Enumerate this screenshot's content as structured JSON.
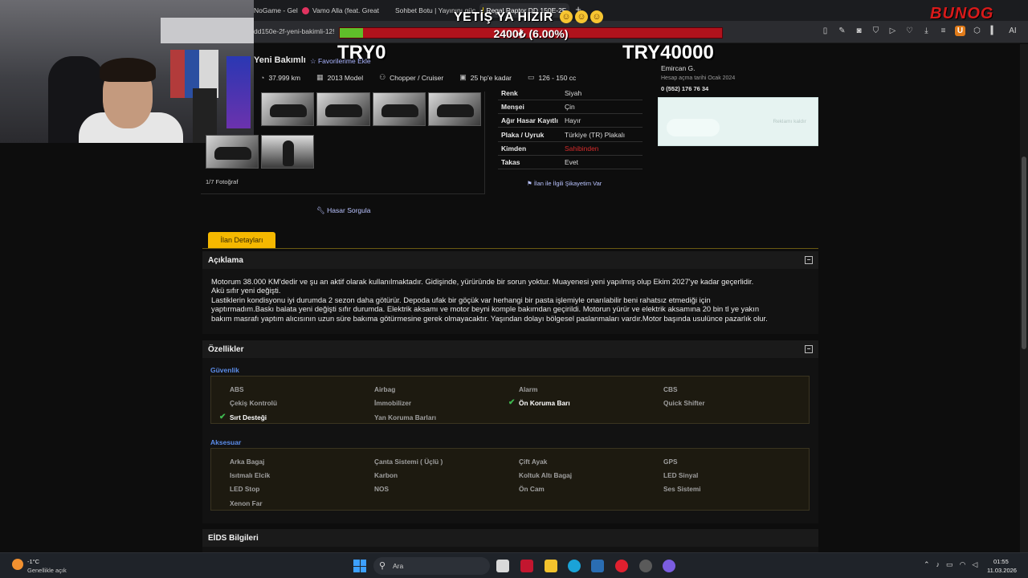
{
  "tabs": [
    {
      "label": "NoGame - Gele"
    },
    {
      "label": "Vamo Alla (feat. Great"
    },
    {
      "label": "Sohbet Botu | Yayınını güç"
    },
    {
      "label": "Regal Raptor DD 150E-2F"
    }
  ],
  "address": {
    "url": "dd150e-2f-yeni-bakimli-12!"
  },
  "overlay": {
    "title": "YETİŞ YA HIZIR",
    "bar_text": "2400₺ (6.00%)",
    "progress_fraction": 0.06,
    "min": "TRY0",
    "max": "TRY40000",
    "logo": "BUNOG",
    "colors": {
      "bar_bg": "#b0121c",
      "bar_fill": "#5fbf2a"
    }
  },
  "listing": {
    "title": "Yeni Bakımlı",
    "favorite": "Favorilerime Ekle",
    "specs": [
      {
        "icon": "speedometer-icon",
        "text": "37.999 km"
      },
      {
        "icon": "calendar-icon",
        "text": "2013 Model"
      },
      {
        "icon": "motorcycle-icon",
        "text": "Chopper / Cruiser"
      },
      {
        "icon": "engine-icon",
        "text": "25 hp'e kadar"
      },
      {
        "icon": "displacement-icon",
        "text": "126 - 150 cc"
      }
    ],
    "photo_count": "1/7 Fotoğraf",
    "hasar": "Hasar Sorgula",
    "complaint": "İlan ile İlgili Şikayetim Var",
    "attrs": [
      {
        "k": "Renk",
        "v": "Siyah"
      },
      {
        "k": "Menşei",
        "v": "Çin"
      },
      {
        "k": "Ağır Hasar Kayıtlı",
        "v": "Hayır"
      },
      {
        "k": "Plaka / Uyruk",
        "v": "Türkiye (TR) Plakalı"
      },
      {
        "k": "Kimden",
        "v": "Sahibinden"
      },
      {
        "k": "Takas",
        "v": "Evet"
      }
    ]
  },
  "seller": {
    "name": "Emircan G.",
    "date": "Hesap açma tarihi  Ocak 2024",
    "phone": "0 (552) 176 76 34",
    "ad_text": "Reklamı kaldır"
  },
  "details": {
    "tab": "İlan Detayları",
    "desc_title": "Açıklama",
    "desc_lines": [
      "Motorum 38.000 KM'dedir ve şu an aktif olarak kullanılmaktadır. Gidişinde, yürüründe bir sorun yoktur. Muayenesi yeni yapılmış olup Ekim 2027'ye kadar geçerlidir.",
      "Akü sıfır yeni değişti.",
      "Lastiklerin kondisyonu iyi durumda 2 sezon daha götürür. Depoda ufak bir göçük var herhangi bir pasta işlemiyle onarılabilir beni rahatsız etmediği için",
      "yaptırmadım.Baskı balata yeni değişti sıfır durumda. Elektrik aksamı ve motor beyni komple bakımdan geçirildi. Motorun yürür ve elektrik aksamına 20 bin tl ye yakın",
      "bakım masrafı yaptım alıcısının uzun süre bakıma götürmesine gerek olmayacaktır. Yaşından dolayı bölgesel paslanmaları vardır.Motor başında usulünce pazarlık olur."
    ],
    "features_title": "Özellikler",
    "guvenlik_title": "Güvenlik",
    "guvenlik": [
      {
        "label": "ABS",
        "on": false
      },
      {
        "label": "Airbag",
        "on": false
      },
      {
        "label": "Alarm",
        "on": false
      },
      {
        "label": "CBS",
        "on": false
      },
      {
        "label": "Çekiş Kontrolü",
        "on": false
      },
      {
        "label": "İmmobilizer",
        "on": false
      },
      {
        "label": "Ön Koruma Barı",
        "on": true
      },
      {
        "label": "Quick Shifter",
        "on": false
      },
      {
        "label": "Sırt Desteği",
        "on": true
      },
      {
        "label": "Yan Koruma Barları",
        "on": false
      }
    ],
    "aksesuar_title": "Aksesuar",
    "aksesuar": [
      {
        "label": "Arka Bagaj",
        "on": false
      },
      {
        "label": "Çanta Sistemi ( Üçlü )",
        "on": false
      },
      {
        "label": "Çift Ayak",
        "on": false
      },
      {
        "label": "GPS",
        "on": false
      },
      {
        "label": "Isıtmalı Elcik",
        "on": false
      },
      {
        "label": "Karbon",
        "on": false
      },
      {
        "label": "Koltuk Altı Bagaj",
        "on": false
      },
      {
        "label": "LED Sinyal",
        "on": false
      },
      {
        "label": "LED Stop",
        "on": false
      },
      {
        "label": "NOS",
        "on": false
      },
      {
        "label": "Ön Cam",
        "on": false
      },
      {
        "label": "Ses Sistemi",
        "on": false
      },
      {
        "label": "Xenon Far",
        "on": false
      }
    ],
    "eids_title": "EİDS Bilgileri"
  },
  "taskbar": {
    "temp": "-1°C",
    "weather": "Genellikle açık",
    "search": "Ara",
    "time": "01:55",
    "date": "11.03.2026"
  }
}
